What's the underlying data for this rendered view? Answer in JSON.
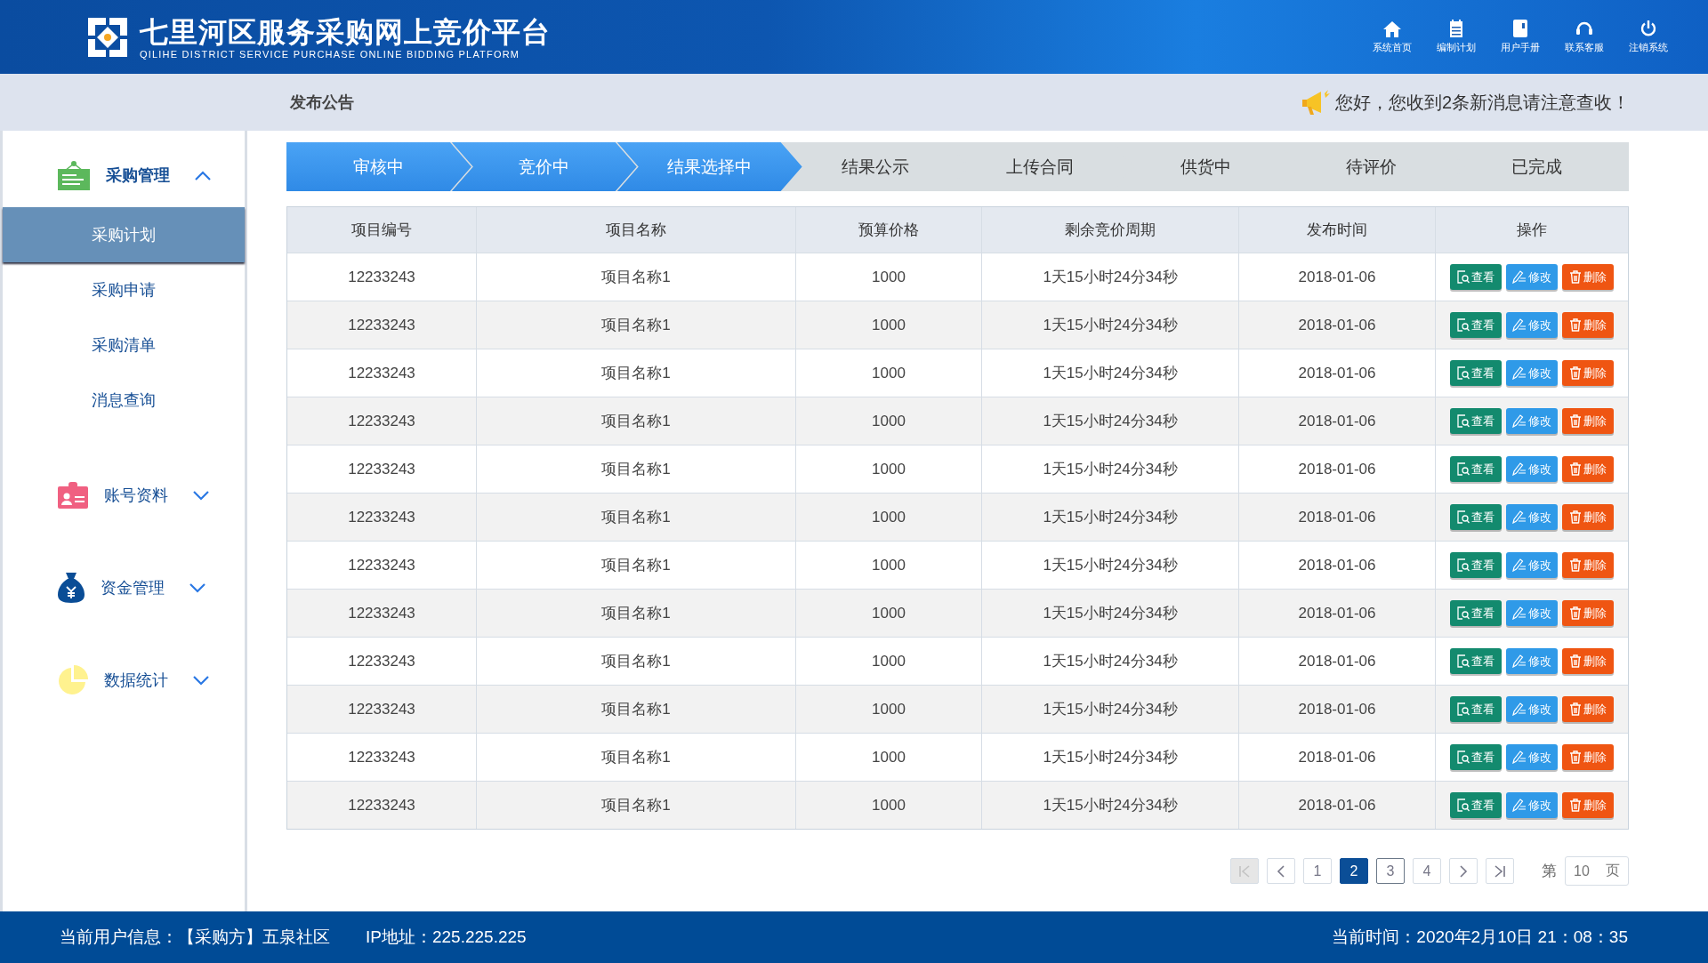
{
  "header": {
    "title": "七里河区服务采购网上竞价平台",
    "subtitle": "QILIHE DISTRICT SERVICE PURCHASE ONLINE BIDDING PLATFORM",
    "nav": [
      {
        "kind": "home",
        "label": "系统首页"
      },
      {
        "kind": "notepad",
        "label": "编制计划"
      },
      {
        "kind": "book",
        "label": "用户手册"
      },
      {
        "kind": "headset",
        "label": "联系客服"
      },
      {
        "kind": "power",
        "label": "注销系统"
      }
    ]
  },
  "subbar": {
    "title": "发布公告",
    "notice": "您好，您收到2条新消息请注意查收！"
  },
  "sidebar": [
    {
      "kind": "cart",
      "label": "采购管理",
      "expanded": true,
      "children": [
        {
          "label": "采购计划",
          "selected": true
        },
        {
          "label": "采购申请",
          "selected": false
        },
        {
          "label": "采购清单",
          "selected": false
        },
        {
          "label": "消息查询",
          "selected": false
        }
      ]
    },
    {
      "kind": "badge",
      "label": "账号资料",
      "expanded": false
    },
    {
      "kind": "moneybag",
      "label": "资金管理",
      "expanded": false
    },
    {
      "kind": "pie",
      "label": "数据统计",
      "expanded": false
    }
  ],
  "steps": [
    {
      "label": "审核中",
      "active": true
    },
    {
      "label": "竞价中",
      "active": true
    },
    {
      "label": "结果选择中",
      "active": true
    },
    {
      "label": "结果公示",
      "active": false
    },
    {
      "label": "上传合同",
      "active": false
    },
    {
      "label": "供货中",
      "active": false
    },
    {
      "label": "待评价",
      "active": false
    },
    {
      "label": "已完成",
      "active": false
    }
  ],
  "table": {
    "columns": [
      "项目编号",
      "项目名称",
      "预算价格",
      "剩余竞价周期",
      "发布时间",
      "操作"
    ],
    "rows": [
      {
        "cells": [
          "12233243",
          "项目名称1",
          "1000",
          "1天15小时24分34秒",
          "2018-01-06"
        ],
        "actions": [
          {
            "kind": "view",
            "label": "查看"
          },
          {
            "kind": "edit",
            "label": "修改"
          },
          {
            "kind": "delete",
            "label": "删除"
          }
        ]
      },
      {
        "cells": [
          "12233243",
          "项目名称1",
          "1000",
          "1天15小时24分34秒",
          "2018-01-06"
        ],
        "actions": [
          {
            "kind": "view",
            "label": "查看"
          },
          {
            "kind": "edit",
            "label": "修改"
          },
          {
            "kind": "delete",
            "label": "删除"
          }
        ]
      },
      {
        "cells": [
          "12233243",
          "项目名称1",
          "1000",
          "1天15小时24分34秒",
          "2018-01-06"
        ],
        "actions": [
          {
            "kind": "view",
            "label": "查看"
          },
          {
            "kind": "edit",
            "label": "修改"
          },
          {
            "kind": "delete",
            "label": "删除"
          }
        ]
      },
      {
        "cells": [
          "12233243",
          "项目名称1",
          "1000",
          "1天15小时24分34秒",
          "2018-01-06"
        ],
        "actions": [
          {
            "kind": "view",
            "label": "查看"
          },
          {
            "kind": "edit",
            "label": "修改"
          },
          {
            "kind": "delete",
            "label": "删除"
          }
        ]
      },
      {
        "cells": [
          "12233243",
          "项目名称1",
          "1000",
          "1天15小时24分34秒",
          "2018-01-06"
        ],
        "actions": [
          {
            "kind": "view",
            "label": "查看"
          },
          {
            "kind": "edit",
            "label": "修改"
          },
          {
            "kind": "delete",
            "label": "删除"
          }
        ]
      },
      {
        "cells": [
          "12233243",
          "项目名称1",
          "1000",
          "1天15小时24分34秒",
          "2018-01-06"
        ],
        "actions": [
          {
            "kind": "view",
            "label": "查看"
          },
          {
            "kind": "edit",
            "label": "修改"
          },
          {
            "kind": "delete",
            "label": "删除"
          }
        ]
      },
      {
        "cells": [
          "12233243",
          "项目名称1",
          "1000",
          "1天15小时24分34秒",
          "2018-01-06"
        ],
        "actions": [
          {
            "kind": "view",
            "label": "查看"
          },
          {
            "kind": "edit",
            "label": "修改"
          },
          {
            "kind": "delete",
            "label": "删除"
          }
        ]
      },
      {
        "cells": [
          "12233243",
          "项目名称1",
          "1000",
          "1天15小时24分34秒",
          "2018-01-06"
        ],
        "actions": [
          {
            "kind": "view",
            "label": "查看"
          },
          {
            "kind": "edit",
            "label": "修改"
          },
          {
            "kind": "delete",
            "label": "删除"
          }
        ]
      },
      {
        "cells": [
          "12233243",
          "项目名称1",
          "1000",
          "1天15小时24分34秒",
          "2018-01-06"
        ],
        "actions": [
          {
            "kind": "view",
            "label": "查看"
          },
          {
            "kind": "edit",
            "label": "修改"
          },
          {
            "kind": "delete",
            "label": "删除"
          }
        ]
      },
      {
        "cells": [
          "12233243",
          "项目名称1",
          "1000",
          "1天15小时24分34秒",
          "2018-01-06"
        ],
        "actions": [
          {
            "kind": "view",
            "label": "查看"
          },
          {
            "kind": "edit",
            "label": "修改"
          },
          {
            "kind": "delete",
            "label": "删除"
          }
        ]
      },
      {
        "cells": [
          "12233243",
          "项目名称1",
          "1000",
          "1天15小时24分34秒",
          "2018-01-06"
        ],
        "actions": [
          {
            "kind": "view",
            "label": "查看"
          },
          {
            "kind": "edit",
            "label": "修改"
          },
          {
            "kind": "delete",
            "label": "删除"
          }
        ]
      },
      {
        "cells": [
          "12233243",
          "项目名称1",
          "1000",
          "1天15小时24分34秒",
          "2018-01-06"
        ],
        "actions": [
          {
            "kind": "view",
            "label": "查看"
          },
          {
            "kind": "edit",
            "label": "修改"
          },
          {
            "kind": "delete",
            "label": "删除"
          }
        ]
      }
    ]
  },
  "pagination": {
    "first_disabled": true,
    "pages": [
      {
        "label": "1",
        "selected": false,
        "focused": false
      },
      {
        "label": "2",
        "selected": true,
        "focused": false
      },
      {
        "label": "3",
        "selected": false,
        "focused": true
      },
      {
        "label": "4",
        "selected": false,
        "focused": false
      }
    ],
    "jump": {
      "prefix": "第",
      "value": "10",
      "suffix": "页"
    }
  },
  "status_bar": {
    "user": "当前用户信息：【采购方】五泉社区",
    "ip": "IP地址：225.225.225",
    "time": "当前时间：2020年2月10日 21：08：35"
  }
}
